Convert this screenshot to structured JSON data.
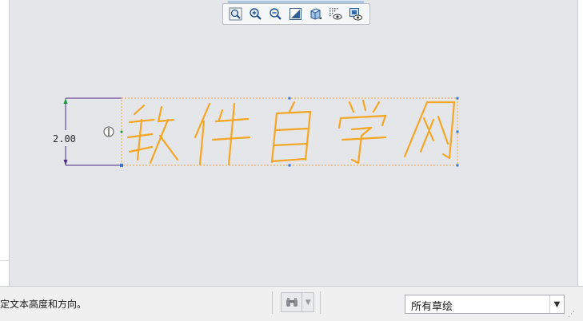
{
  "toolbar": {
    "buttons": [
      {
        "name": "refit-button",
        "icon": "refit-icon"
      },
      {
        "name": "zoom-in-button",
        "icon": "zoom-in-icon"
      },
      {
        "name": "zoom-out-button",
        "icon": "zoom-out-icon"
      },
      {
        "name": "repaint-button",
        "icon": "repaint-icon"
      },
      {
        "name": "display-style-button",
        "icon": "cube-icon"
      },
      {
        "name": "sketcher-display-button",
        "icon": "grid-eye-icon"
      },
      {
        "name": "sketch-view-button",
        "icon": "sketch-view-icon"
      }
    ]
  },
  "sketch": {
    "text": "软件自学网",
    "dimension": "2.00",
    "colors": {
      "text_stroke": "#f5a623",
      "dimension": "#4b2a8a",
      "box": "#f0a030",
      "handle": "#3a78d8"
    }
  },
  "status": {
    "message": "定文本高度和方向。",
    "filter_value": "所有草绘"
  }
}
